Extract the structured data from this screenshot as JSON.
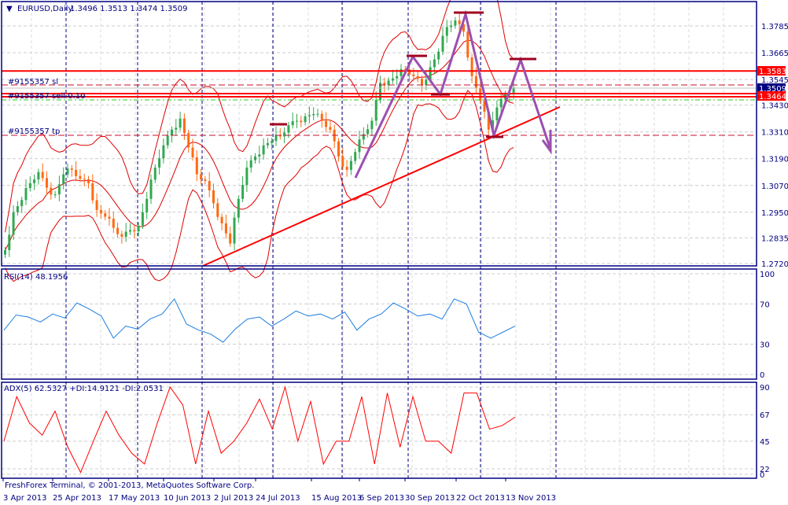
{
  "window": {
    "symbol_title": "EURUSD,Daily",
    "ohlc": "1.3496 1.3513 1.3474 1.3509",
    "copyright": "FreshForex Terminal, © 2001-2013, MetaQuotes Software Corp."
  },
  "colors": {
    "frame": "#000080",
    "bull": "#32a852",
    "bear": "#ff6a13",
    "band": "#e00000",
    "rsi": "#1e7fe0",
    "adx": "#ff0000",
    "wave": "#9b4fb0",
    "level": "#ff0000"
  },
  "chart_data": [
    {
      "type": "candlestick",
      "title": "EURUSD,Daily",
      "ylim": [
        1.27,
        1.386
      ],
      "y_ticks": [
        "1.3785",
        "1.3665",
        "1.3545",
        "1.3430",
        "1.3310",
        "1.3190",
        "1.3070",
        "1.2950",
        "1.2835",
        "1.2720"
      ],
      "x_ticks": [
        "3 Apr 2013",
        "25 Apr 2013",
        "17 May 2013",
        "10 Jun 2013",
        "2 Jul 2013",
        "24 Jul 2013",
        "15 Aug 2013",
        "6 Sep 2013",
        "30 Sep 2013",
        "22 Oct 2013",
        "13 Nov 2013"
      ],
      "closes": [
        1.278,
        1.295,
        1.3005,
        1.308,
        1.313,
        1.306,
        1.303,
        1.312,
        1.314,
        1.31,
        1.308,
        1.296,
        1.293,
        1.288,
        1.284,
        1.287,
        1.289,
        1.301,
        1.315,
        1.325,
        1.332,
        1.337,
        1.324,
        1.312,
        1.309,
        1.299,
        1.29,
        1.281,
        1.301,
        1.315,
        1.32,
        1.325,
        1.327,
        1.329,
        1.334,
        1.336,
        1.338,
        1.339,
        1.336,
        1.332,
        1.32,
        1.314,
        1.322,
        1.33,
        1.336,
        1.353,
        1.354,
        1.356,
        1.359,
        1.356,
        1.352,
        1.36,
        1.367,
        1.378,
        1.381,
        1.376,
        1.356,
        1.345,
        1.332,
        1.342,
        1.348,
        1.3509
      ],
      "price_labels": {
        "level_high": "1.3583",
        "bid": "1.3509",
        "level_entry": "1.3464"
      },
      "orders": {
        "sl_label": "#9155357 sl",
        "entry_label": "#9155357 sell 0.10",
        "tp_label": "#9155357 tp"
      }
    },
    {
      "type": "line",
      "title": "RSI(14) 48.1956",
      "ylim": [
        0,
        100
      ],
      "y_ticks": [
        "100",
        "70",
        "30",
        "0"
      ],
      "values": [
        44,
        59,
        57,
        52,
        60,
        56,
        71,
        65,
        58,
        36,
        48,
        45,
        55,
        60,
        75,
        50,
        44,
        40,
        32,
        45,
        55,
        57,
        48,
        55,
        63,
        58,
        60,
        55,
        62,
        44,
        55,
        60,
        71,
        65,
        58,
        60,
        55,
        75,
        70,
        42,
        36,
        42,
        48
      ]
    },
    {
      "type": "line",
      "title": "ADX(5) 62.5327 +DI:14.9121 -DI:2.0531",
      "ylim": [
        0,
        100
      ],
      "y_ticks": [
        "90",
        "67",
        "45",
        "22",
        "0"
      ],
      "values": [
        45,
        82,
        60,
        50,
        70,
        40,
        19,
        45,
        70,
        50,
        35,
        26,
        60,
        90,
        75,
        26,
        70,
        35,
        45,
        60,
        80,
        55,
        90,
        45,
        78,
        26,
        45,
        45,
        82,
        26,
        85,
        40,
        82,
        45,
        45,
        35,
        85,
        85,
        55,
        58,
        65
      ]
    }
  ]
}
